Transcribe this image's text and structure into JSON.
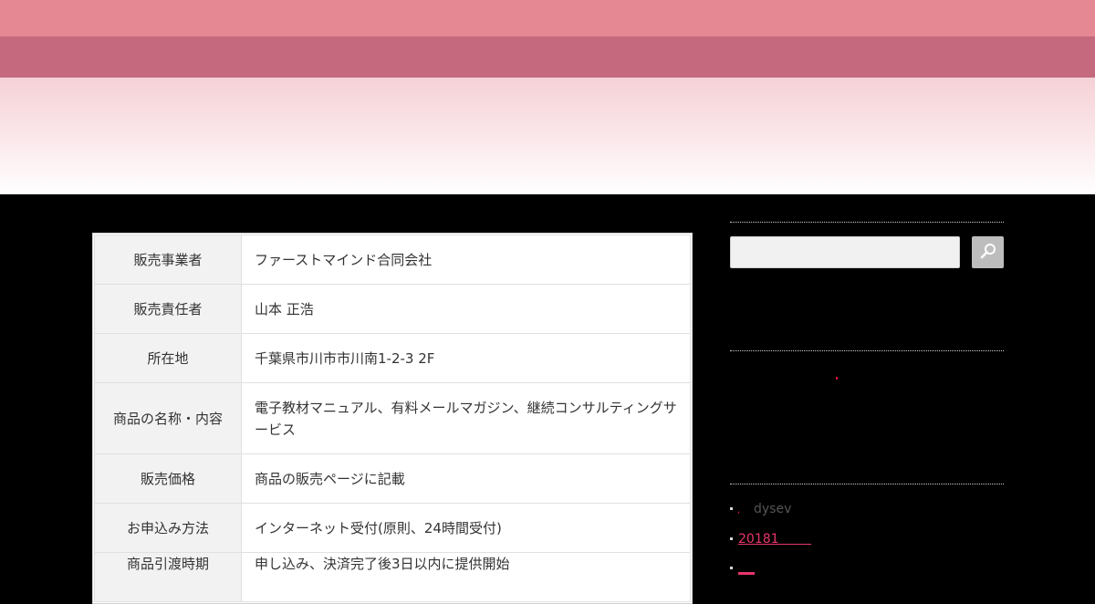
{
  "header": {
    "colors": {
      "top_band": "#e58893",
      "mid_band": "#c4697e",
      "fade_start": "#f5d1d6"
    }
  },
  "info_table": {
    "rows": [
      {
        "label": "販売事業者",
        "value": "ファーストマインド合同会社"
      },
      {
        "label": "販売責任者",
        "value": "山本 正浩"
      },
      {
        "label": "所在地",
        "value": "千葉県市川市市川南1-2-3 2F"
      },
      {
        "label": "商品の名称・内容",
        "value": "電子教材マニュアル、有料メールマガジン、継続コンサルティングサービス"
      },
      {
        "label": "販売価格",
        "value": "商品の販売ページに記載"
      },
      {
        "label": "お申込み方法",
        "value": "インターネット受付(原則、24時間受付)"
      },
      {
        "label": "商品引渡時期",
        "value": "申し込み、決済完了後3日以内に提供開始"
      }
    ]
  },
  "sidebar": {
    "search": {
      "placeholder": "",
      "icon": "search-icon"
    },
    "list": [
      {
        "label": "dysev"
      },
      {
        "label": "20181"
      },
      {
        "label": ""
      }
    ],
    "colors": {
      "link": "#e8366b"
    }
  }
}
